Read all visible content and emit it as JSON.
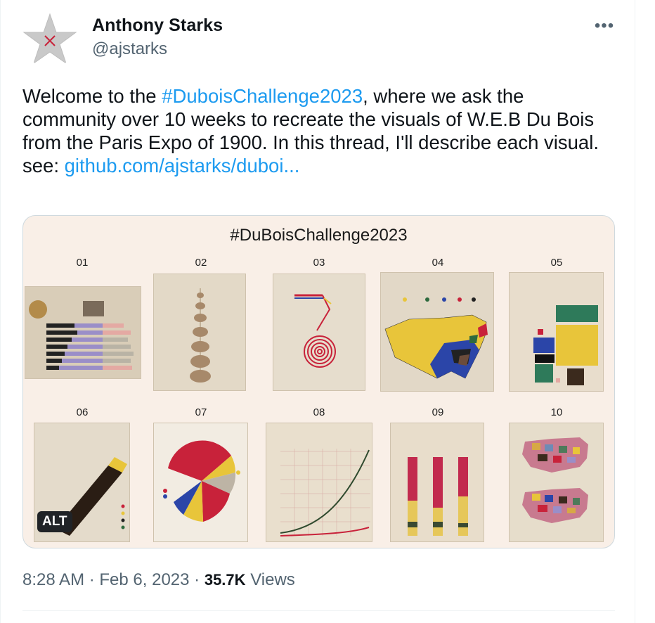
{
  "author": {
    "name": "Anthony Starks",
    "handle": "@ajstarks"
  },
  "more_label": "•••",
  "tweet": {
    "line1_before": "Welcome to the ",
    "hashtag": "#DuboisChallenge2023",
    "line1_after": ", where we ask the community over 10 weeks  to recreate the visuals of W.E.B Du Bois from the Paris Expo of 1900.  In this thread, I'll describe each visual.",
    "see_label": "see: ",
    "link_text": "github.com/ajstarks/duboi..."
  },
  "media": {
    "title": "#DuBoisChallenge2023",
    "numbers": [
      "01",
      "02",
      "03",
      "04",
      "05",
      "06",
      "07",
      "08",
      "09",
      "10"
    ],
    "alt_label": "ALT"
  },
  "meta": {
    "time": "8:28 AM",
    "sep1": " · ",
    "date": "Feb 6, 2023",
    "sep2": " · ",
    "views_count": "35.7K",
    "views_label": " Views"
  },
  "colors": {
    "link": "#1d9bf0",
    "secondary": "#536471",
    "dubois_red": "#c8223a",
    "dubois_yellow": "#e8c53a",
    "dubois_blue": "#2b45a8",
    "dubois_green": "#2e6a3e"
  }
}
